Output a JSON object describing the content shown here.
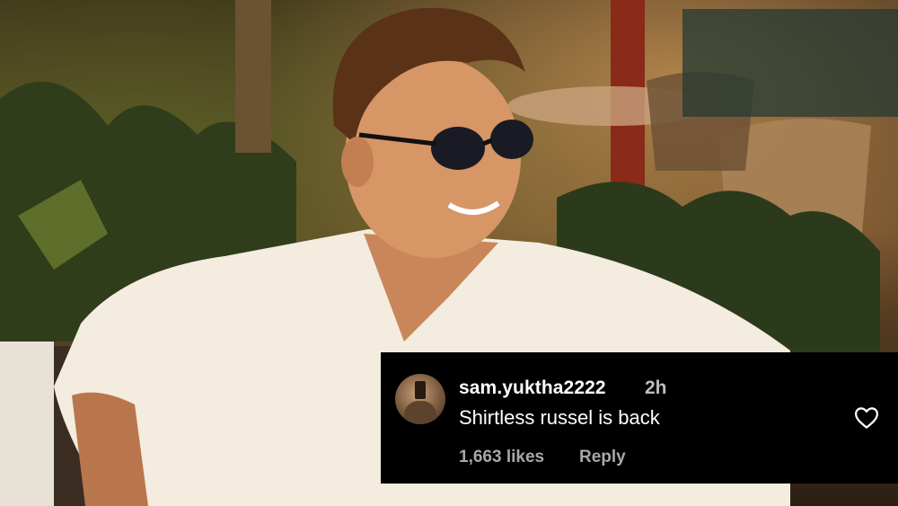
{
  "comment": {
    "username": "sam.yuktha2222",
    "time": "2h",
    "text": "Shirtless russel is back",
    "likes": "1,663 likes",
    "reply_label": "Reply"
  },
  "icons": {
    "avatar": "avatar-photo",
    "heart": "heart-outline-icon"
  },
  "colors": {
    "card_background": "#000000",
    "text_primary": "#ffffff",
    "text_secondary": "#a8a8a8"
  }
}
